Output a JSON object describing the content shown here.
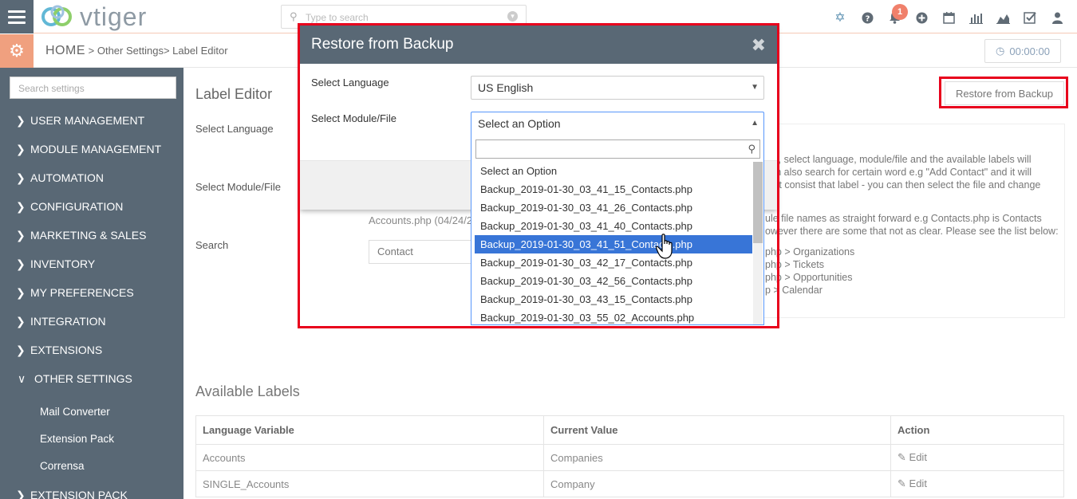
{
  "app": {
    "logo_text": "vtiger",
    "search_placeholder": "Type to search",
    "notification_count": "1"
  },
  "icons": [
    "hamburger-icon",
    "vtiger-logo",
    "search-icon",
    "chevron-down-icon",
    "help-icon",
    "bell-icon",
    "add-icon",
    "calendar-icon",
    "reports-icon",
    "chart-icon",
    "tasks-icon",
    "user-icon",
    "gear-icon",
    "clock-icon",
    "pencil-icon",
    "close-icon",
    "hand-cursor-icon"
  ],
  "breadcrumb": {
    "home": "HOME",
    "sep1": ">",
    "level1": "Other Settings",
    "sep2": ">",
    "level2": "Label Editor"
  },
  "timer": "00:00:00",
  "sidebar": {
    "search_placeholder": "Search settings",
    "items": [
      {
        "label": "USER MANAGEMENT"
      },
      {
        "label": "MODULE MANAGEMENT"
      },
      {
        "label": "AUTOMATION"
      },
      {
        "label": "CONFIGURATION"
      },
      {
        "label": "MARKETING & SALES"
      },
      {
        "label": "INVENTORY"
      },
      {
        "label": "MY PREFERENCES"
      },
      {
        "label": "INTEGRATION"
      },
      {
        "label": "EXTENSIONS"
      },
      {
        "label": "OTHER SETTINGS"
      }
    ],
    "subitems": [
      {
        "label": "Mail Converter"
      },
      {
        "label": "Extension Pack"
      },
      {
        "label": "Corrensa"
      }
    ],
    "last_item": "EXTENSION PACK"
  },
  "main": {
    "title": "Label Editor",
    "restore_button": "Restore from Backup",
    "select_language_label": "Select Language",
    "select_module_label": "Select Module/File",
    "search_label": "Search",
    "accounts_note": "Accounts.php (04/24/2",
    "search_value": "Contact",
    "info_lines": [
      "bel, select language, module/file and the available labels will",
      "can also search for certain word e.g \"Add Contact\" and it will",
      "that consist that label - you can then select the file and change",
      "ule file names as straight forward e.g Contacts.php is Contacts",
      "owever there are some that not as clear. Please see the list below:",
      "php > Organizations",
      "php > Tickets",
      "php > Opportunities",
      "p > Calendar"
    ],
    "available_title": "Available Labels",
    "table": {
      "headers": [
        "Language Variable",
        "Current Value",
        "Action"
      ],
      "rows": [
        [
          "Accounts",
          "Companies",
          "Edit"
        ],
        [
          "SINGLE_Accounts",
          "Company",
          "Edit"
        ]
      ]
    }
  },
  "modal": {
    "title": "Restore from Backup",
    "language_label": "Select Language",
    "language_value": "US English",
    "module_label": "Select Module/File",
    "module_value": "Select an Option",
    "options": [
      "Select an Option",
      "Backup_2019-01-30_03_41_15_Contacts.php",
      "Backup_2019-01-30_03_41_26_Contacts.php",
      "Backup_2019-01-30_03_41_40_Contacts.php",
      "Backup_2019-01-30_03_41_51_Contacts.php",
      "Backup_2019-01-30_03_42_17_Contacts.php",
      "Backup_2019-01-30_03_42_56_Contacts.php",
      "Backup_2019-01-30_03_43_15_Contacts.php",
      "Backup_2019-01-30_03_55_02_Accounts.php"
    ],
    "active_option_index": 4
  },
  "colors": {
    "sidebar": "#596875",
    "accent_orange": "#f0a07f",
    "highlight_red": "#e8001c",
    "option_active": "#3875d7"
  }
}
